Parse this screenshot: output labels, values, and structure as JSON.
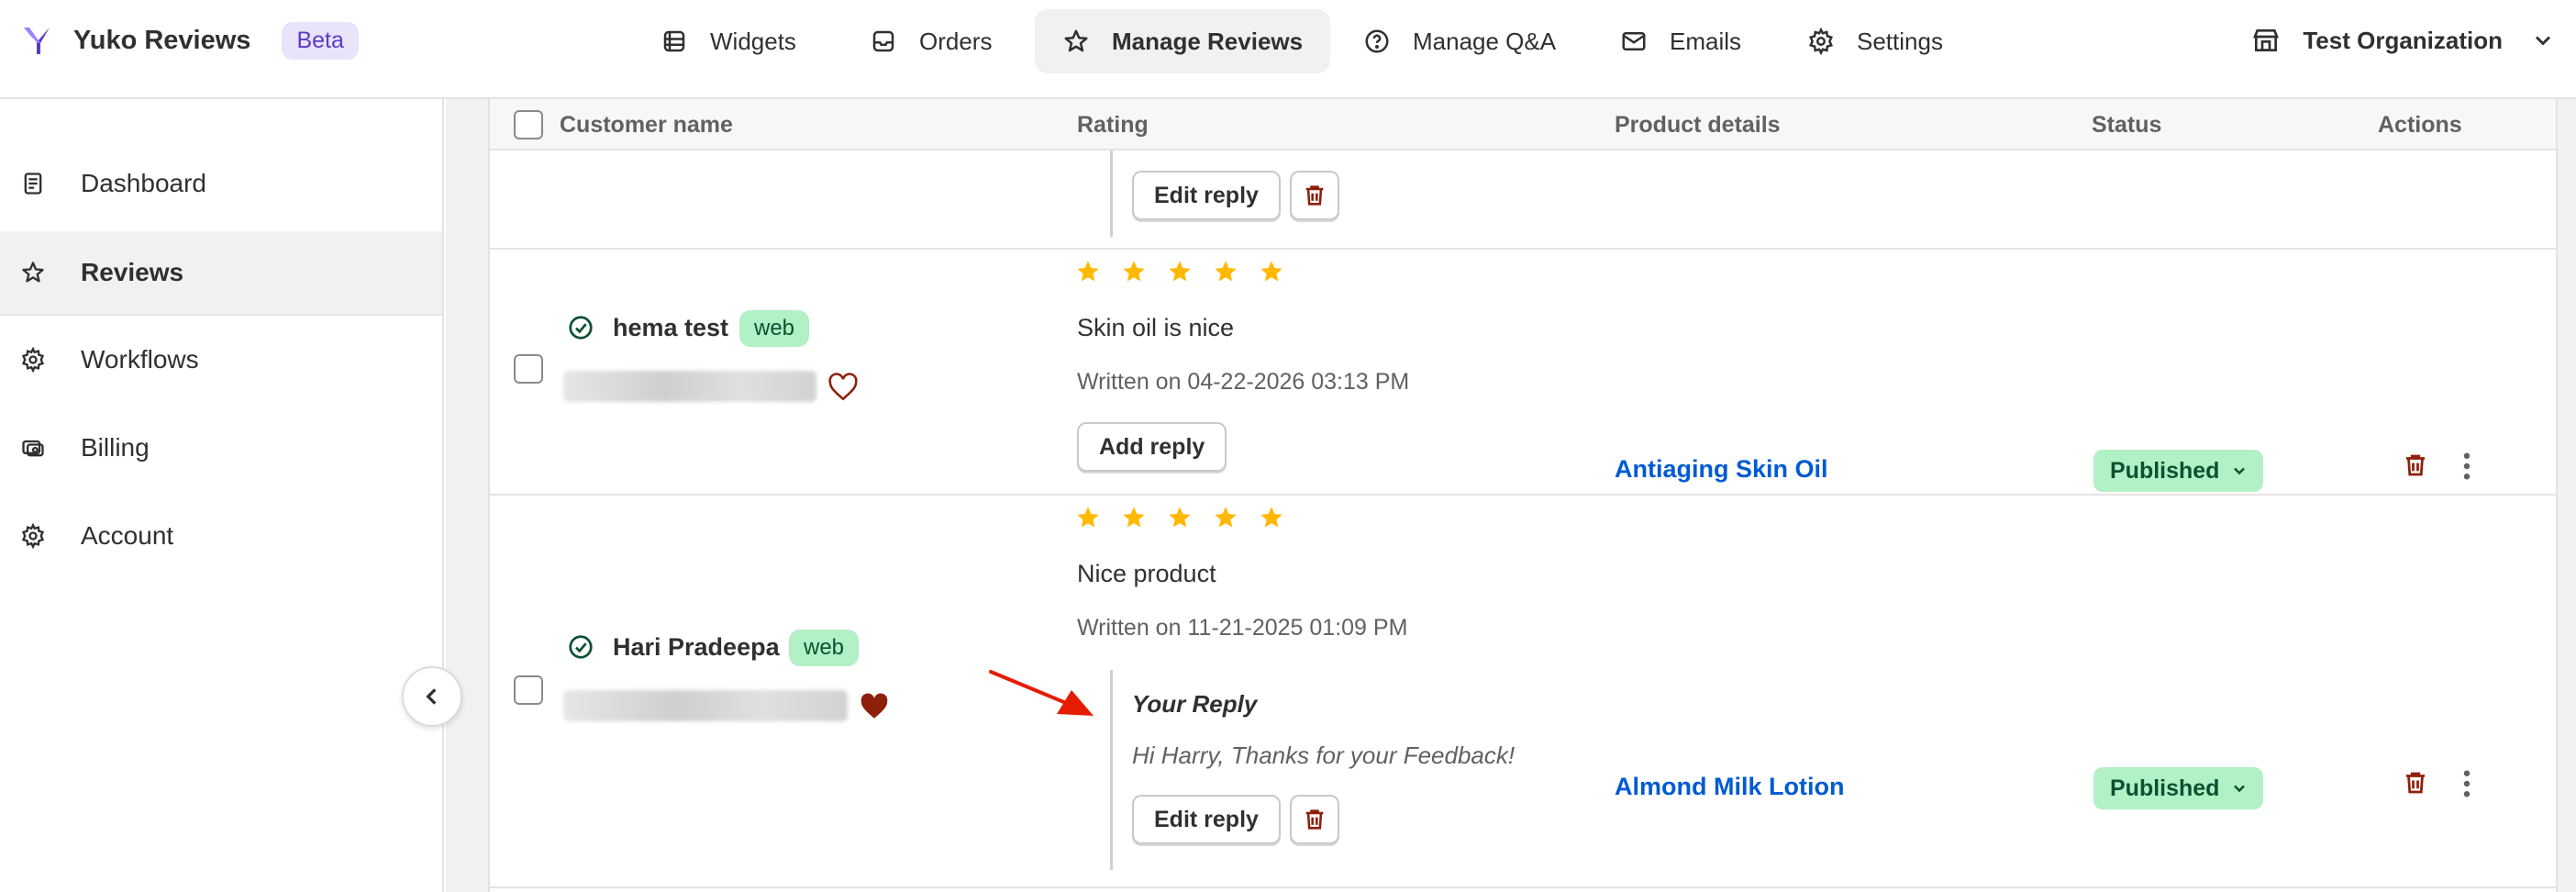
{
  "app": {
    "name": "Yuko Reviews",
    "badge": "Beta"
  },
  "nav": [
    {
      "label": "Widgets",
      "icon": "widgets-icon"
    },
    {
      "label": "Orders",
      "icon": "inbox-icon"
    },
    {
      "label": "Manage Reviews",
      "icon": "star-icon"
    },
    {
      "label": "Manage Q&A",
      "icon": "question-circle-icon"
    },
    {
      "label": "Emails",
      "icon": "email-icon"
    },
    {
      "label": "Settings",
      "icon": "gear-icon"
    }
  ],
  "org": {
    "label": "Test Organization",
    "icon": "store-icon"
  },
  "sidebar": [
    {
      "label": "Dashboard",
      "icon": "document-icon"
    },
    {
      "label": "Reviews",
      "icon": "star-icon"
    },
    {
      "label": "Workflows",
      "icon": "gear-icon"
    },
    {
      "label": "Billing",
      "icon": "billing-icon"
    },
    {
      "label": "Account",
      "icon": "gear-icon"
    }
  ],
  "table": {
    "columns": [
      "Customer name",
      "Rating",
      "Product details",
      "Status",
      "Actions"
    ],
    "partial_row": {
      "edit_reply_label": "Edit reply"
    },
    "rows": [
      {
        "customer": "hema test",
        "source": "web",
        "favorited": false,
        "stars": 5,
        "review": "Skin oil is nice",
        "written": "Written on 04-22-2026 03:13 PM",
        "reply_button": "Add reply",
        "product": "Antiaging Skin Oil",
        "status": "Published"
      },
      {
        "customer": "Hari Pradeepa",
        "source": "web",
        "favorited": true,
        "stars": 5,
        "review": "Nice product",
        "written": "Written on 11-21-2025 01:09 PM",
        "reply_title": "Your Reply",
        "reply_body": "Hi Harry, Thanks for your Feedback!",
        "reply_button": "Edit reply",
        "product": "Almond Milk Lotion",
        "status": "Published"
      }
    ]
  },
  "colors": {
    "accent_link": "#005bd3",
    "star": "#ffb800",
    "published_bg": "#b2f0c5",
    "published_text": "#0c5132",
    "delete": "#8e1f0b",
    "arrow": "#e51c00",
    "heart_filled": "#8e1f0b"
  }
}
